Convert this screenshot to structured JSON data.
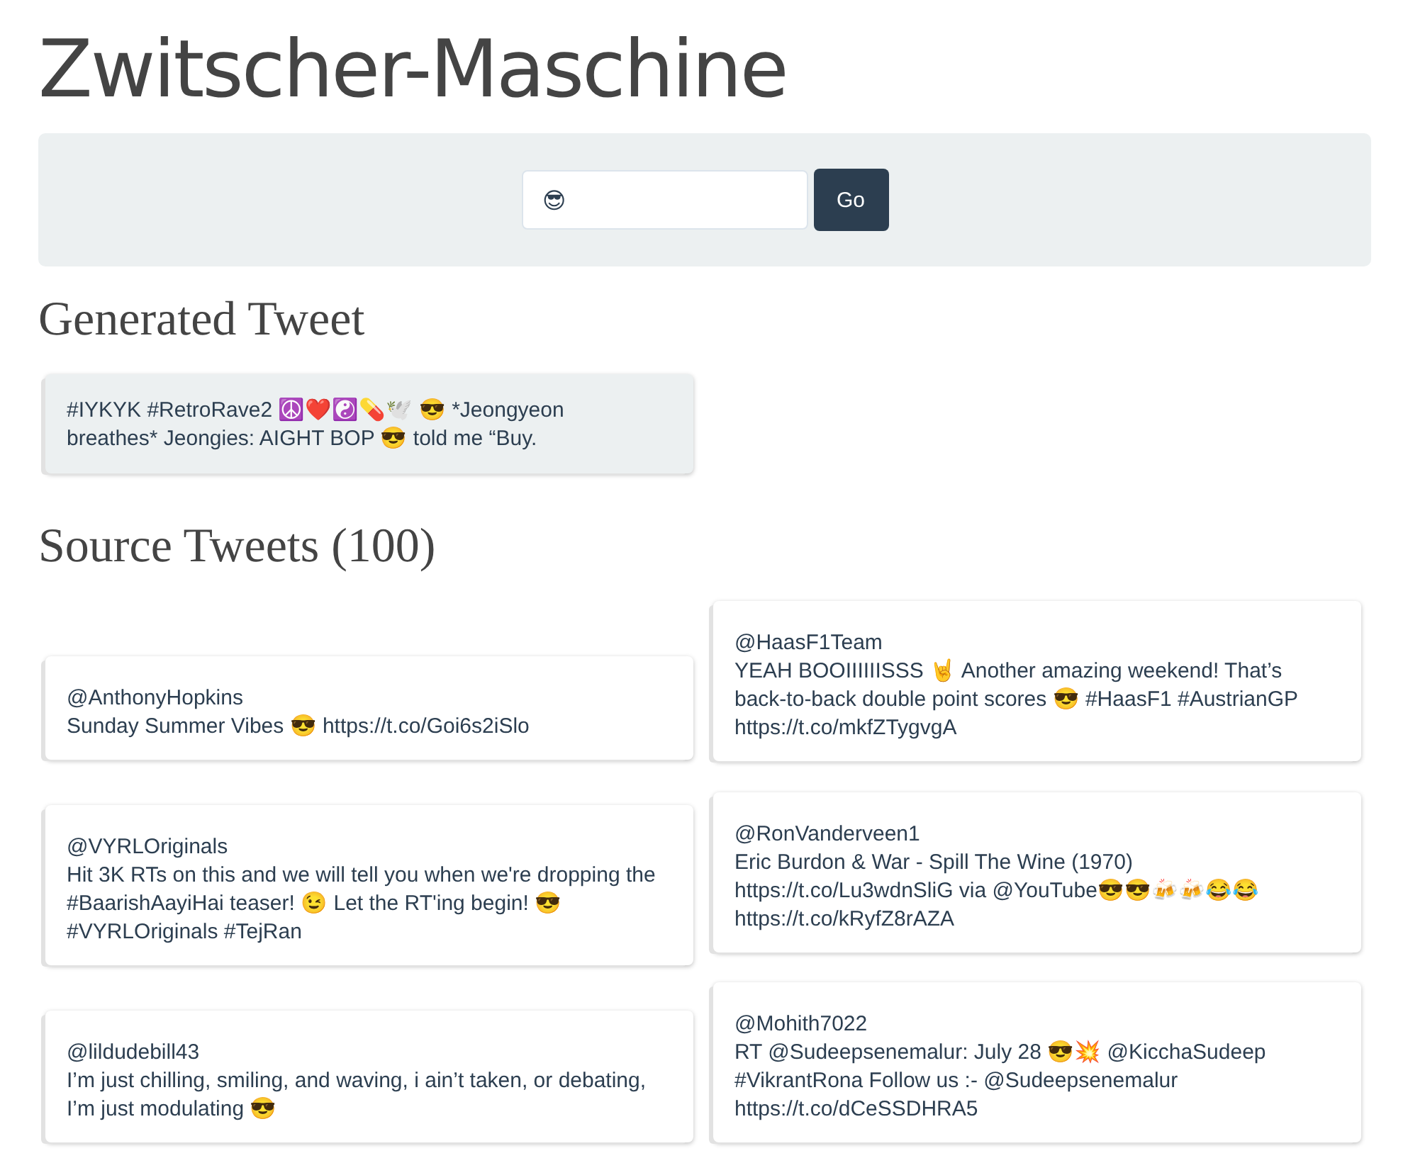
{
  "title": "Zwitscher-Maschine",
  "search": {
    "value": "😎",
    "button": "Go"
  },
  "generated": {
    "heading": "Generated Tweet",
    "text": "#IYKYK #RetroRave2 ☮️❤️☯️💊🕊️ 😎 *Jeongyeon breathes* Jeongies: AIGHT BOP 😎 told me “Buy."
  },
  "source": {
    "heading": "Source Tweets (100)",
    "columns": [
      {
        "tweets": [
          {
            "user": "@AnthonyHopkins",
            "text": "Sunday Summer Vibes 😎 https://t.co/Goi6s2iSlo"
          },
          {
            "user": "@VYRLOriginals",
            "text": "Hit 3K RTs on this and we will tell you when we're dropping the #BaarishAayiHai teaser! 😉 Let the RT'ing begin! 😎 #VYRLOriginals #TejRan"
          },
          {
            "user": "@lildudebill43",
            "text": "I’m just chilling, smiling, and waving, i ain’t taken, or debating, I’m just modulating 😎"
          }
        ]
      },
      {
        "tweets": [
          {
            "user": "@HaasF1Team",
            "text": "YEAH BOOIIIIIISSS 🤘 Another amazing weekend! That’s back-to-back double point scores 😎 #HaasF1 #AustrianGP https://t.co/mkfZTygvgA"
          },
          {
            "user": "@RonVanderveen1",
            "text": "Eric Burdon & War - Spill The Wine (1970) https://t.co/Lu3wdnSliG via @YouTube😎😎🍻🍻😂😂 https://t.co/kRyfZ8rAZA"
          },
          {
            "user": "@Mohith7022",
            "text": "RT @Sudeepsenemalur: July 28 😎💥 @KicchaSudeep #VikrantRona Follow us :- @Sudeepsenemalur https://t.co/dCeSSDHRA5"
          }
        ]
      }
    ]
  }
}
